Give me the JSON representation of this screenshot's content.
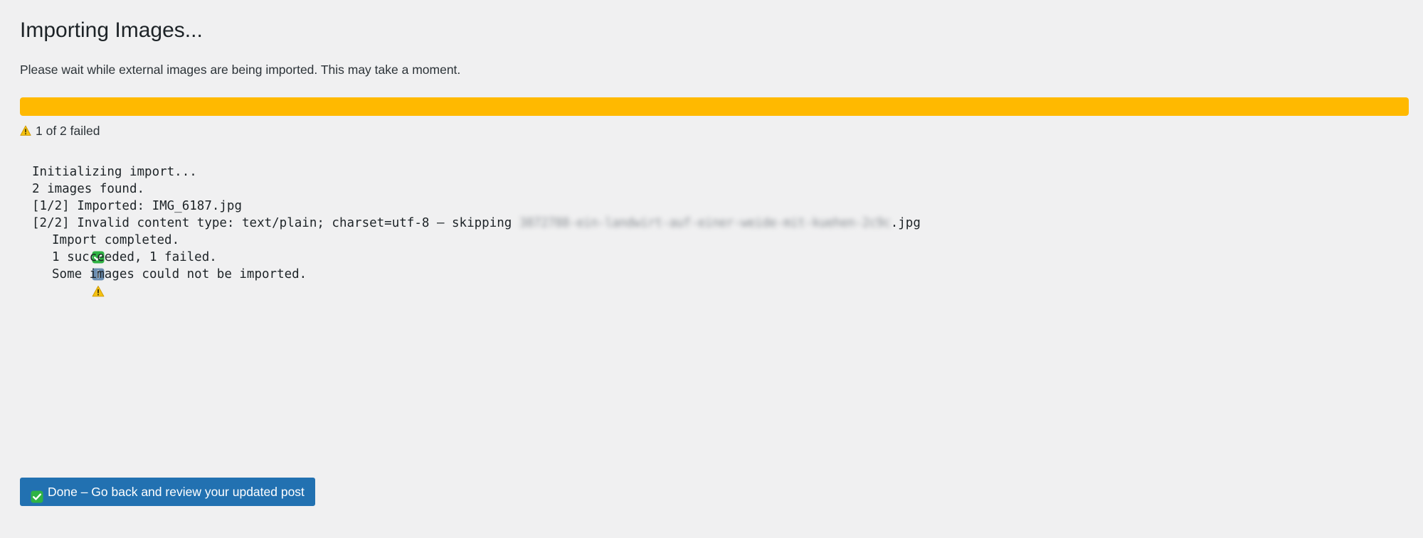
{
  "page": {
    "title": "Importing Images...",
    "description": "Please wait while external images are being imported. This may take a moment."
  },
  "progress": {
    "percent": 100,
    "color": "#ffb900",
    "status_icon": "warning-icon",
    "status_text": "1 of 2 failed"
  },
  "log": {
    "lines": [
      {
        "icon": null,
        "text": "Initializing import..."
      },
      {
        "icon": null,
        "text": "2 images found."
      },
      {
        "icon": null,
        "text": "[1/2] Imported: IMG_6187.jpg"
      },
      {
        "icon": null,
        "text_before": "[2/2] Invalid content type: text/plain; charset=utf-8 – skipping ",
        "text_blurred": "3872788-ein-landwirt-auf-einer-weide-mit-kuehen-2c9c",
        "text_after": ".jpg"
      },
      {
        "icon": "check-icon",
        "text": "Import completed."
      },
      {
        "icon": "info-icon",
        "text": "1 succeeded, 1 failed."
      },
      {
        "icon": "warning-icon",
        "text": "Some images could not be imported."
      }
    ]
  },
  "done_button": {
    "icon": "check-icon",
    "label": "Done – Go back and review your updated post",
    "color": "#2271b1"
  }
}
